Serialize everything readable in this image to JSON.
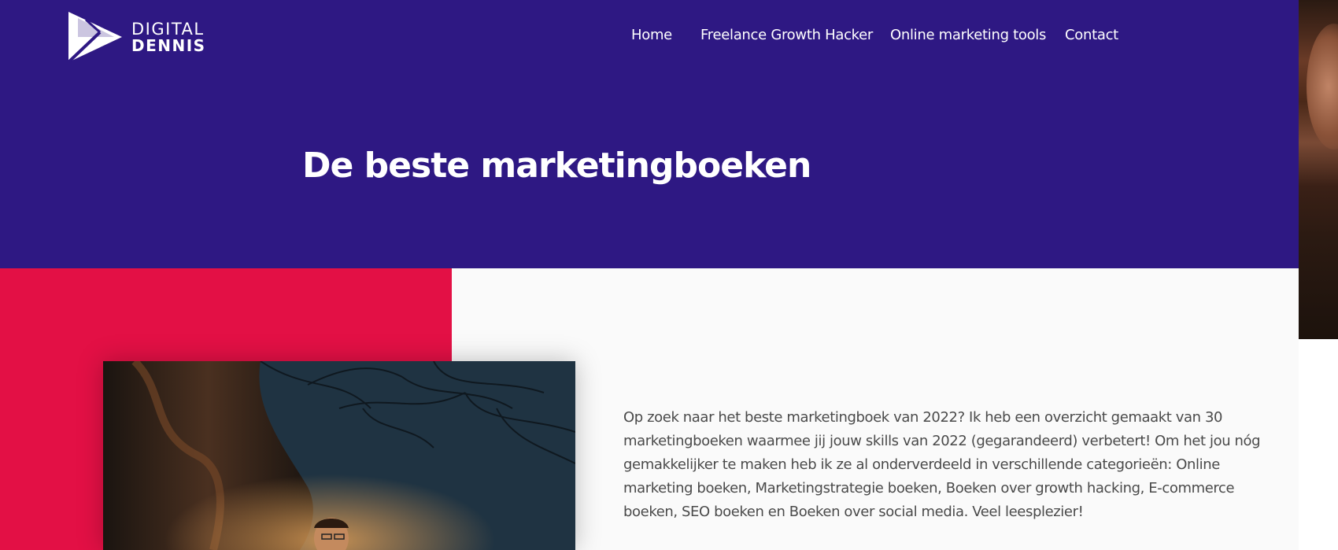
{
  "brand": {
    "line1": "DIGITAL",
    "line2": "DENNIS",
    "logo_icon": "triangle-play-logo"
  },
  "nav": {
    "items": [
      {
        "label": "Home"
      },
      {
        "label": "Freelance Growth Hacker"
      },
      {
        "label": "Online marketing tools"
      },
      {
        "label": "Contact"
      }
    ]
  },
  "hero": {
    "title": "De beste marketingboeken"
  },
  "intro": {
    "text": "Op zoek naar het beste marketingboek van 2022? Ik heb een overzicht gemaakt van 30 marketingboeken waarmee jij jouw skills van 2022 (gegarandeerd) verbetert! Om het jou nóg gemakkelijker te maken heb ik ze al onderverdeeld in verschillende categorieën: Online marketing boeken, Marketingstrategie boeken, Boeken over growth hacking, E-commerce boeken, SEO boeken en Boeken over social media. Veel leesplezier!"
  },
  "colors": {
    "header_bg": "#2e1883",
    "accent_red": "#e31045",
    "body_bg": "#fafafa",
    "text": "#4a4a4a"
  }
}
